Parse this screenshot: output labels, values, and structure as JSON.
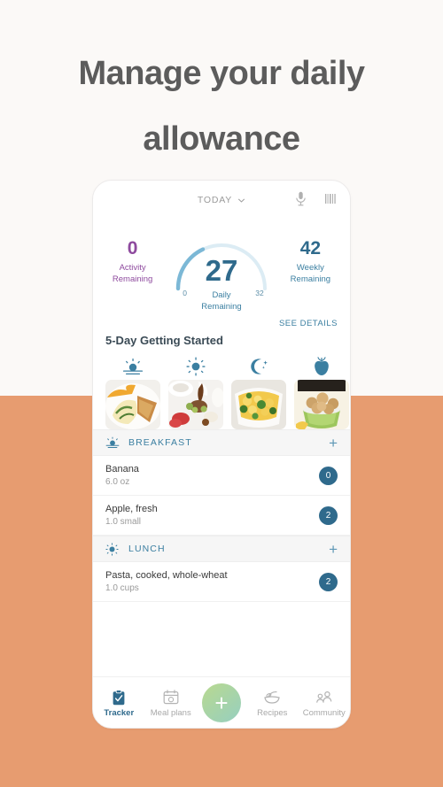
{
  "colors": {
    "background_top": "#fbf9f7",
    "background_bottom": "#e79c70",
    "accent_blue": "#2f6a8c",
    "accent_purple": "#8e4a9e",
    "gauge_track": "#dcecf4",
    "gauge_fill": "#7cb8d6",
    "fab_green": "#b9d98f"
  },
  "headline": {
    "line1": "Manage your daily",
    "line2": "allowance"
  },
  "app": {
    "header": {
      "date_label": "TODAY",
      "chevron_icon": "chevron-down-icon",
      "mic_icon": "microphone-icon",
      "barcode_icon": "barcode-scanner-icon"
    },
    "stats": {
      "activity": {
        "value": "0",
        "label_line1": "Activity",
        "label_line2": "Remaining"
      },
      "daily": {
        "value": "27",
        "label_line1": "Daily",
        "label_line2": "Remaining",
        "min_tick": "0",
        "max_tick": "32"
      },
      "weekly": {
        "value": "42",
        "label_line1": "Weekly",
        "label_line2": "Remaining"
      }
    },
    "getting_started": {
      "see_details": "SEE DETAILS",
      "title": "5-Day Getting Started",
      "items": [
        {
          "icon": "sunrise-icon",
          "thumb": "omelette-toast-photo"
        },
        {
          "icon": "sun-icon",
          "thumb": "salad-bowl-photo"
        },
        {
          "icon": "moon-stars-icon",
          "thumb": "pasta-broccoli-photo"
        },
        {
          "icon": "apple-icon",
          "thumb": "energy-balls-photo"
        }
      ]
    },
    "meals": [
      {
        "icon": "sunrise-icon",
        "name": "BREAKFAST",
        "add_label": "+",
        "foods": [
          {
            "name": "Banana",
            "amount": "6.0 oz",
            "points": "0"
          },
          {
            "name": "Apple, fresh",
            "amount": "1.0 small",
            "points": "2"
          }
        ]
      },
      {
        "icon": "sun-icon",
        "name": "LUNCH",
        "add_label": "+",
        "foods": [
          {
            "name": "Pasta, cooked, whole-wheat",
            "amount": "1.0 cups",
            "points": "2"
          }
        ]
      }
    ],
    "bottom_nav": {
      "items": [
        {
          "label": "Tracker",
          "icon": "clipboard-check-icon",
          "active": true
        },
        {
          "label": "Meal plans",
          "icon": "calendar-icon",
          "active": false
        },
        {
          "label": "Recipes",
          "icon": "bowl-spoon-icon",
          "active": false
        },
        {
          "label": "Community",
          "icon": "people-icon",
          "active": false
        }
      ],
      "fab_label": "+",
      "fab_icon": "plus-icon"
    }
  }
}
